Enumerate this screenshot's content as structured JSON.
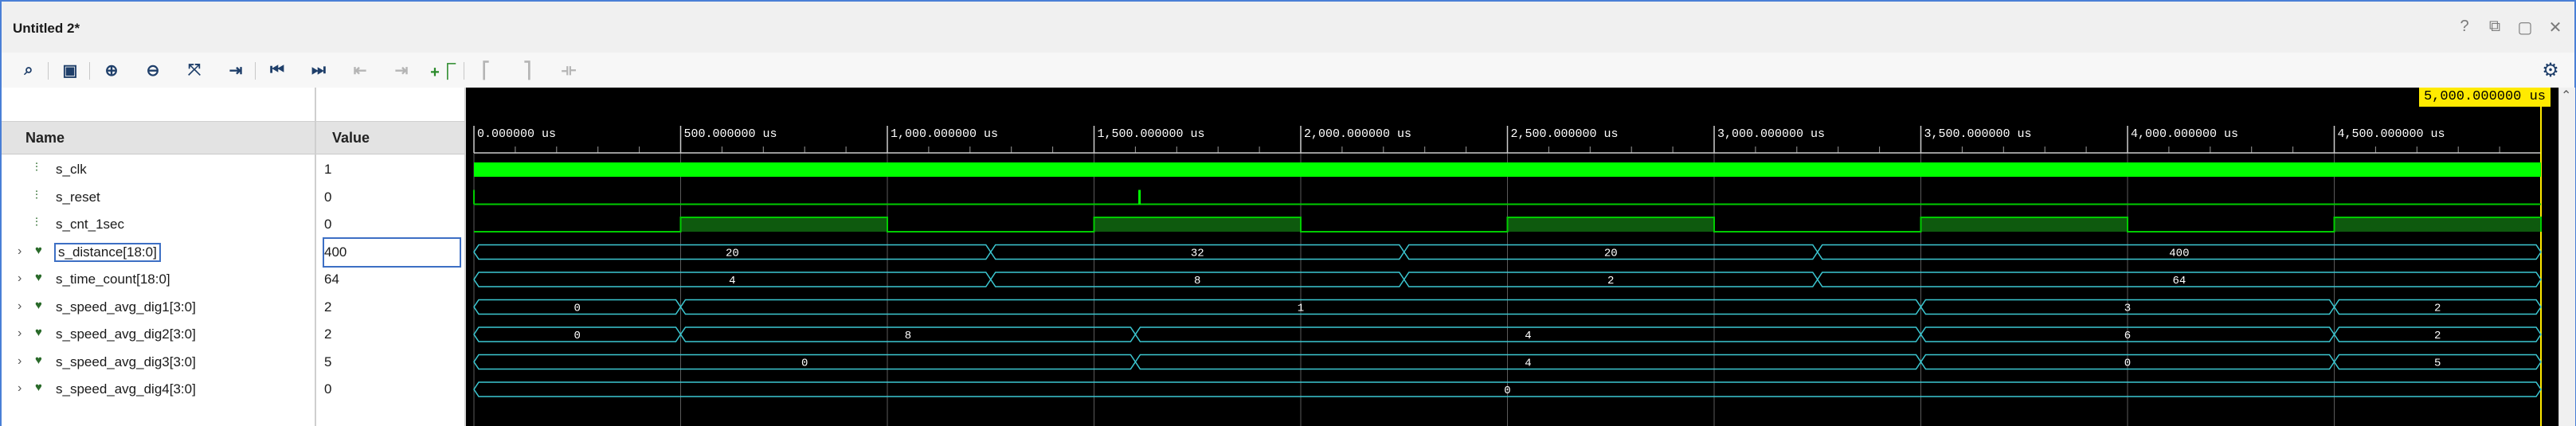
{
  "window": {
    "title": "Untitled 2*",
    "controls": [
      "?",
      "⧉",
      "▢",
      "✕"
    ]
  },
  "toolbar": {
    "icons": [
      "search-icon",
      "save-icon",
      "zoom-in-icon",
      "zoom-out-icon",
      "zoom-fit-icon",
      "go-to-cursor-icon",
      "go-to-start-icon",
      "go-to-end-icon",
      "previous-transition-icon",
      "next-transition-icon",
      "add-marker-icon",
      "previous-marker-icon",
      "next-marker-icon",
      "swap-cursors-icon"
    ],
    "settings_icon": "gear-icon"
  },
  "columns": {
    "name": "Name",
    "value": "Value"
  },
  "signals": [
    {
      "name": "s_clk",
      "value": "1",
      "kind": "bit",
      "expandable": false
    },
    {
      "name": "s_reset",
      "value": "0",
      "kind": "bit",
      "expandable": false
    },
    {
      "name": "s_cnt_1sec",
      "value": "0",
      "kind": "bit",
      "expandable": false
    },
    {
      "name": "s_distance[18:0]",
      "value": "400",
      "kind": "bus",
      "expandable": true,
      "selected": true
    },
    {
      "name": "s_time_count[18:0]",
      "value": "64",
      "kind": "bus",
      "expandable": true
    },
    {
      "name": "s_speed_avg_dig1[3:0]",
      "value": "2",
      "kind": "bus",
      "expandable": true
    },
    {
      "name": "s_speed_avg_dig2[3:0]",
      "value": "2",
      "kind": "bus",
      "expandable": true
    },
    {
      "name": "s_speed_avg_dig3[3:0]",
      "value": "5",
      "kind": "bus",
      "expandable": true
    },
    {
      "name": "s_speed_avg_dig4[3:0]",
      "value": "0",
      "kind": "bus",
      "expandable": true
    }
  ],
  "timeline": {
    "unit": "us",
    "range": [
      0,
      5000
    ],
    "cursor_label": "5,000.000000 us",
    "ticks": [
      {
        "t": 0,
        "label": "0.000000 us"
      },
      {
        "t": 500,
        "label": "500.000000 us"
      },
      {
        "t": 1000,
        "label": "1,000.000000 us"
      },
      {
        "t": 1500,
        "label": "1,500.000000 us"
      },
      {
        "t": 2000,
        "label": "2,000.000000 us"
      },
      {
        "t": 2500,
        "label": "2,500.000000 us"
      },
      {
        "t": 3000,
        "label": "3,000.000000 us"
      },
      {
        "t": 3500,
        "label": "3,500.000000 us"
      },
      {
        "t": 4000,
        "label": "4,000.000000 us"
      },
      {
        "t": 4500,
        "label": "4,500.000000 us"
      }
    ]
  },
  "waves": {
    "s_reset_pulse_t": 1610,
    "s_cnt_1sec_high": [
      [
        500,
        1000
      ],
      [
        1500,
        2000
      ],
      [
        2500,
        3000
      ],
      [
        3500,
        4000
      ],
      [
        4500,
        5000
      ]
    ],
    "buses": [
      {
        "segments": [
          {
            "start": 0,
            "end": 1250,
            "value": "20"
          },
          {
            "start": 1250,
            "end": 2250,
            "value": "32"
          },
          {
            "start": 2250,
            "end": 3250,
            "value": "20"
          },
          {
            "start": 3250,
            "end": 5000,
            "value": "400"
          }
        ]
      },
      {
        "segments": [
          {
            "start": 0,
            "end": 1250,
            "value": "4"
          },
          {
            "start": 1250,
            "end": 2250,
            "value": "8"
          },
          {
            "start": 2250,
            "end": 3250,
            "value": "2"
          },
          {
            "start": 3250,
            "end": 5000,
            "value": "64"
          }
        ]
      },
      {
        "segments": [
          {
            "start": 0,
            "end": 500,
            "value": "0"
          },
          {
            "start": 500,
            "end": 3500,
            "value": "1"
          },
          {
            "start": 3500,
            "end": 4500,
            "value": "3"
          },
          {
            "start": 4500,
            "end": 5000,
            "value": "2"
          }
        ]
      },
      {
        "segments": [
          {
            "start": 0,
            "end": 500,
            "value": "0"
          },
          {
            "start": 500,
            "end": 1600,
            "value": "8"
          },
          {
            "start": 1600,
            "end": 3500,
            "value": "4"
          },
          {
            "start": 3500,
            "end": 4500,
            "value": "6"
          },
          {
            "start": 4500,
            "end": 5000,
            "value": "2"
          }
        ]
      },
      {
        "segments": [
          {
            "start": 0,
            "end": 1600,
            "value": "0"
          },
          {
            "start": 1600,
            "end": 3500,
            "value": "4"
          },
          {
            "start": 3500,
            "end": 4500,
            "value": "0"
          },
          {
            "start": 4500,
            "end": 5000,
            "value": "5"
          }
        ]
      },
      {
        "segments": [
          {
            "start": 0,
            "end": 5000,
            "value": "0"
          }
        ]
      }
    ]
  },
  "colors": {
    "clock": "#00ff00",
    "bit": "#00cc00",
    "bit_fill": "#0e5a0e",
    "bus": "#3cc8d2",
    "grid": "#5a5a5a"
  }
}
